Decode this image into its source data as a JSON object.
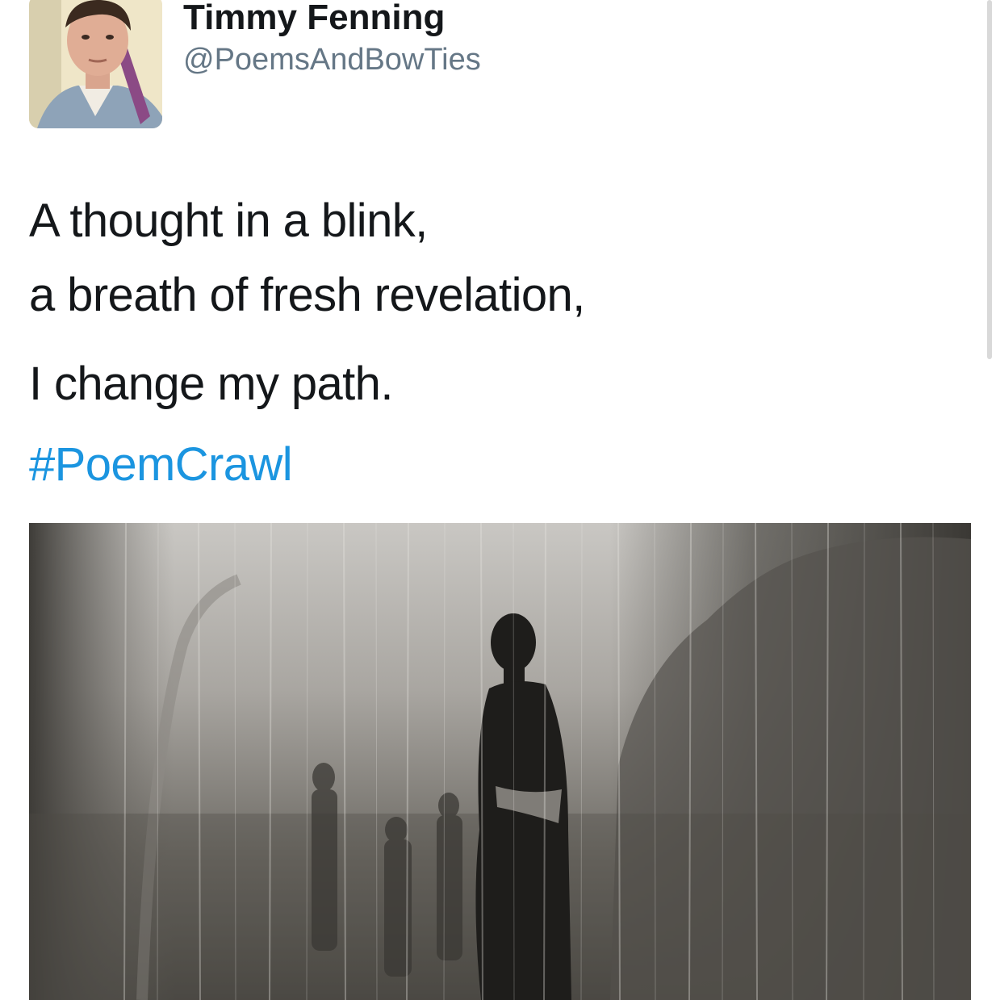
{
  "tweet": {
    "author": {
      "display_name": "Timmy Fenning",
      "handle": "@PoemsAndBowTies",
      "avatar_icon": "profile-photo"
    },
    "text_lines": [
      "A thought in a blink,",
      "a breath of fresh revelation,",
      "I change my path."
    ],
    "hashtag": "#PoemCrawl",
    "media_icon": "photo-silhouette-in-rain"
  },
  "colors": {
    "text": "#14171a",
    "handle": "#657786",
    "link": "#1b95e0",
    "background": "#ffffff"
  }
}
